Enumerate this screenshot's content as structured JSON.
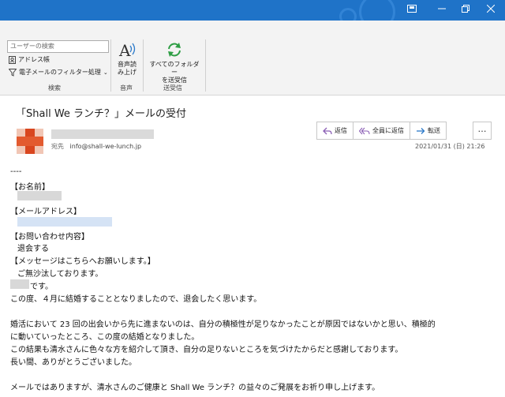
{
  "ribbon": {
    "search_placeholder": "ユーザーの検索",
    "address_book": "アドレス帳",
    "filter_email": "電子メールのフィルター処理",
    "group_search": "検索",
    "speech_btn_line1": "音声読",
    "speech_btn_line2": "み上げ",
    "group_speech": "音声",
    "sendrecv_line1": "すべてのフォルダー",
    "sendrecv_line2": "を送受信",
    "group_sendrecv": "送受信"
  },
  "message": {
    "subject": "「Shall We ランチ？」メールの受付",
    "to_label": "宛先",
    "to_address": "info@shall-we-lunch.jp",
    "date": "2021/01/31 (日) 21:26",
    "actions": {
      "reply": "返信",
      "reply_all": "全員に返信",
      "forward": "転送",
      "more": "…"
    },
    "body": {
      "dashes": "----",
      "name_header": "【お名前】",
      "email_header": "【メールアドレス】",
      "inquiry_header": "【お問い合わせ内容】",
      "inquiry_value": "退会する",
      "message_header": "【メッセージはこちらへお願いします。】",
      "greeting": "ご無沙汰しております。",
      "desu": "です。",
      "line1": "この度、４月に結婚することとなりましたので、退会したく思います。",
      "line2": "婚活において 23 回の出会いから先に進まないのは、自分の積極性が足りなかったことが原因ではないかと思い、積極的",
      "line3": "に動いていったところ、この度の結婚となりました。",
      "line4": "この結果も清水さんに色々な方を紹介して頂き、自分の足りないところを気づけたからだと感謝しております。",
      "line5": "長い間、ありがとうございました。",
      "line6": "メールではありますが、清水さんのご健康と Shall We ランチ？の益々のご発展をお祈り申し上げます。"
    }
  },
  "colors": {
    "titlebar": "#1f73c8",
    "accent_green": "#2e9e44",
    "reply_purple": "#8b5fb5",
    "forward_blue": "#2b79c9"
  }
}
